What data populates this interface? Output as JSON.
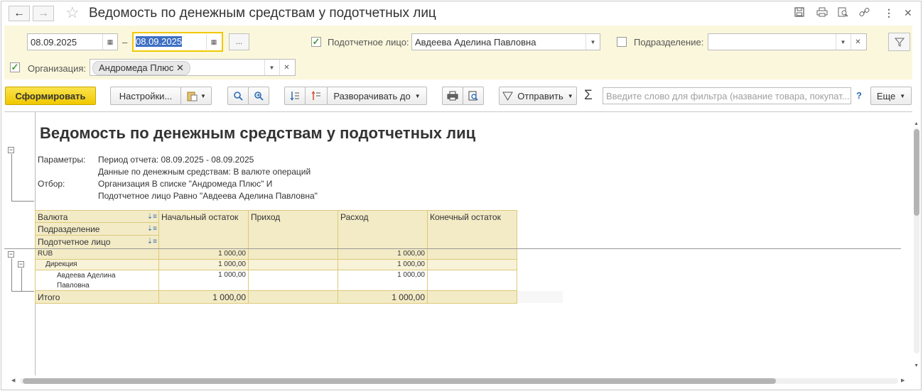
{
  "window": {
    "title": "Ведомость по денежным средствам у подотчетных лиц",
    "back_icon": "←",
    "forward_icon": "→",
    "star_icon": "☆"
  },
  "filters": {
    "date_from": "08.09.2025",
    "date_dash": "–",
    "date_to": "08.09.2025",
    "period_button": "...",
    "accountable_label": "Подотчетное лицо:",
    "accountable_value": "Авдеева Аделина Павловна",
    "accountable_checked": true,
    "division_label": "Подразделение:",
    "division_value": "",
    "division_checked": false,
    "org_label": "Организация:",
    "org_value": "Андромеда Плюс",
    "org_checked": true
  },
  "toolbar": {
    "generate": "Сформировать",
    "settings": "Настройки...",
    "expand_to": "Разворачивать до",
    "send": "Отправить",
    "sigma": "Σ",
    "search_placeholder": "Введите слово для фильтра (название товара, покупат...",
    "help": "?",
    "more": "Еще"
  },
  "report": {
    "title": "Ведомость по денежным средствам у подотчетных лиц",
    "params_label": "Параметры:",
    "params_lines": [
      "Период отчета: 08.09.2025 - 08.09.2025",
      "Данные по денежным средствам: В валюте операций"
    ],
    "filter_label": "Отбор:",
    "filter_lines": [
      "Организация В списке \"Андромеда Плюс\" И",
      "Подотчетное лицо Равно \"Авдеева Аделина Павловна\""
    ],
    "group_headers": [
      "Валюта",
      "Подразделение",
      "Подотчетное лицо"
    ],
    "columns": [
      "Начальный остаток",
      "Приход",
      "Расход",
      "Конечный остаток"
    ],
    "rows": [
      {
        "name": "RUB",
        "start": "1 000,00",
        "in": "",
        "out": "1 000,00",
        "end": ""
      },
      {
        "name": "Дирекция",
        "start": "1 000,00",
        "in": "",
        "out": "1 000,00",
        "end": ""
      },
      {
        "name_line1": "Авдеева Аделина",
        "name_line2": "Павловна",
        "start": "1 000,00",
        "in": "",
        "out": "1 000,00",
        "end": ""
      }
    ],
    "total": {
      "name": "Итого",
      "start": "1 000,00",
      "in": "",
      "out": "1 000,00",
      "end": ""
    }
  }
}
